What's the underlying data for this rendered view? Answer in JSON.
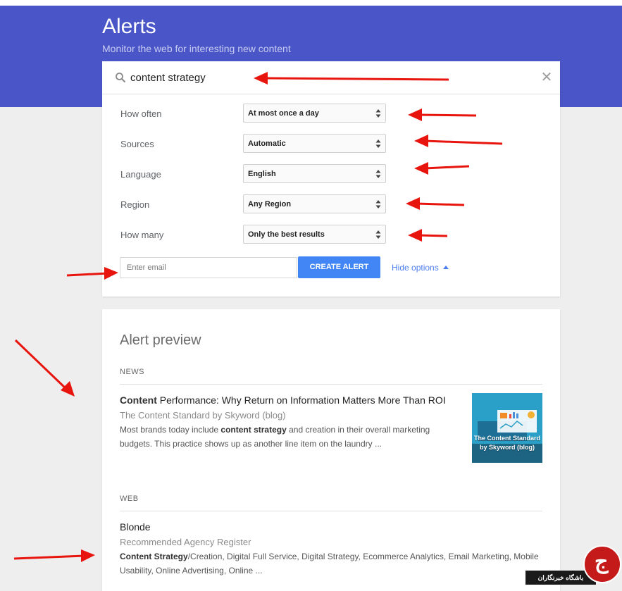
{
  "header": {
    "title": "Alerts",
    "subtitle": "Monitor the web for interesting new content"
  },
  "search": {
    "query": "content strategy",
    "icon": "search-icon",
    "clear_icon": "close-icon"
  },
  "options": [
    {
      "label": "How often",
      "value": "At most once a day"
    },
    {
      "label": "Sources",
      "value": "Automatic"
    },
    {
      "label": "Language",
      "value": "English"
    },
    {
      "label": "Region",
      "value": "Any Region"
    },
    {
      "label": "How many",
      "value": "Only the best results"
    }
  ],
  "email": {
    "placeholder": "Enter email",
    "value": ""
  },
  "create_button": "CREATE ALERT",
  "hide_options": "Hide options",
  "preview": {
    "title": "Alert preview",
    "news_heading": "NEWS",
    "news_item": {
      "title_bold": "Content",
      "title_rest": " Performance: Why Return on Information Matters More Than ROI",
      "source": "The Content Standard by Skyword (blog)",
      "snippet_a": "Most brands today include ",
      "snippet_bold": "content strategy",
      "snippet_b": " and creation in their overall marketing budgets. This practice shows up as another line item on the laundry ...",
      "thumbnail_caption": "The Content Standard by Skyword (blog)"
    },
    "web_heading": "WEB",
    "web_item": {
      "title": "Blonde",
      "source": "Recommended Agency Register",
      "snippet_bold": "Content Strategy",
      "snippet_rest": "/Creation, Digital Full Service, Digital Strategy, Ecommerce Analytics, Email Marketing, Mobile Usability, Online Advertising, Online ..."
    }
  },
  "watermark": {
    "text": "باشگاه خبرنگاران"
  },
  "colors": {
    "header_bg": "#4a55c8",
    "button_blue": "#4285f4",
    "link_blue": "#4c7ef0",
    "annotation_red": "#e8150e"
  }
}
